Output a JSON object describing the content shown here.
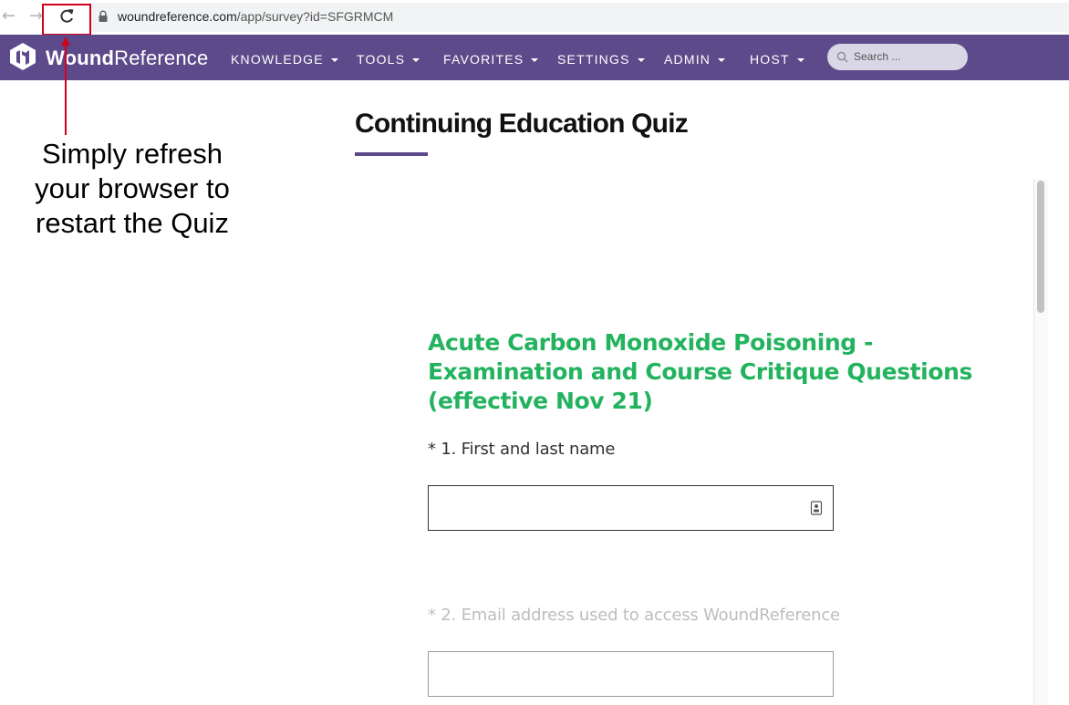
{
  "browser": {
    "url_host": "woundreference.com",
    "url_path": "/app/survey?id=SFGRMCM",
    "back_icon": "back-arrow-icon",
    "forward_icon": "forward-arrow-icon",
    "reload_icon": "reload-icon"
  },
  "site": {
    "logo_bold": "Wound",
    "logo_rest": "Reference",
    "nav": [
      "KNOWLEDGE",
      "TOOLS",
      "FAVORITES",
      "SETTINGS",
      "ADMIN",
      "HOST"
    ],
    "search_placeholder": "Search ...",
    "brand_color": "#5c4a8a"
  },
  "annotation": {
    "lines": [
      "Simply refresh",
      "your browser to",
      "restart the Quiz"
    ],
    "color": "#d0021b"
  },
  "page": {
    "title": "Continuing Education Quiz"
  },
  "survey": {
    "title": "Acute Carbon Monoxide Poisoning - Examination and Course Critique Questions (effective Nov 21)",
    "title_color": "#23b35f",
    "questions": [
      {
        "label": "* 1. First and last name",
        "value": ""
      },
      {
        "label": "* 2. Email address used to access WoundReference",
        "value": ""
      }
    ]
  }
}
